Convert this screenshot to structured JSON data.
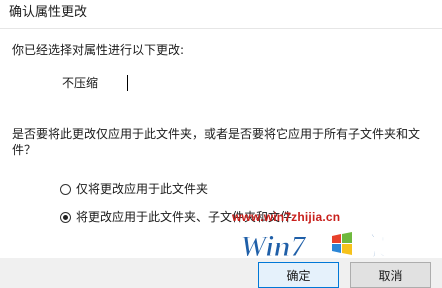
{
  "window": {
    "title": "确认属性更改"
  },
  "prompt": "你已经选择对属性进行以下更改:",
  "attribute_change": "不压缩",
  "question_line1": "是否要将此更改仅应用于此文件夹，或者是否要将它应用于所有子文件夹和文",
  "question_line2": "件？",
  "options": [
    {
      "label": "仅将更改应用于此文件夹",
      "selected": false
    },
    {
      "label": "将更改应用于此文件夹、子文件夹和文件",
      "selected": true
    }
  ],
  "watermark": {
    "url": "www.win7zhijia.cn",
    "logo_text": "Win7",
    "logo_suffix": "家"
  },
  "buttons": {
    "ok": "确定",
    "cancel": "取消"
  }
}
